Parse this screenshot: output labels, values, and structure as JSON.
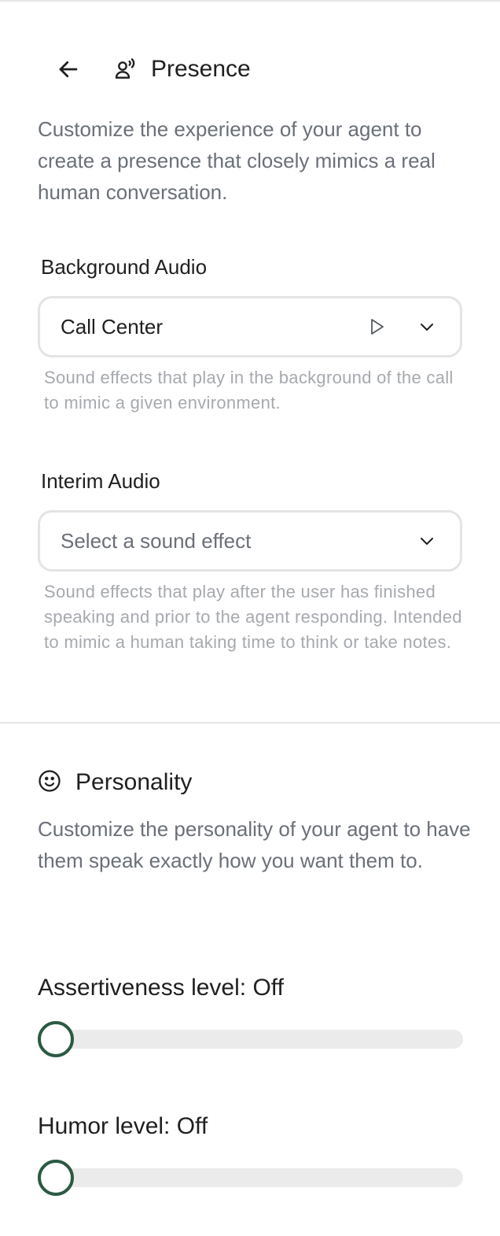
{
  "header": {
    "title": "Presence",
    "back_icon": "arrow-left-icon",
    "title_icon": "person-voice-icon"
  },
  "intro": "Customize the experience of your agent to create a presence that closely mimics a real human conversation.",
  "background_audio": {
    "label": "Background Audio",
    "value": "Call Center",
    "play_icon": "play-icon",
    "chevron_icon": "chevron-down-icon",
    "help": "Sound effects that play in the background of the call to mimic a given environment."
  },
  "interim_audio": {
    "label": "Interim Audio",
    "placeholder": "Select a sound effect",
    "chevron_icon": "chevron-down-icon",
    "help": "Sound effects that play after the user has finished speaking and prior to the agent responding. Intended to mimic a human taking time to think or take notes."
  },
  "personality": {
    "title": "Personality",
    "icon": "smiley-icon",
    "description": "Customize the personality of your agent to have them speak exactly how you want them to."
  },
  "sliders": [
    {
      "label": "Assertiveness level: Off",
      "value": 0
    },
    {
      "label": "Humor level: Off",
      "value": 0
    }
  ],
  "colors": {
    "accent": "#2b5a44",
    "track": "#ebebeb",
    "muted_text": "#6b7078",
    "help_text": "#a6a9ae"
  }
}
